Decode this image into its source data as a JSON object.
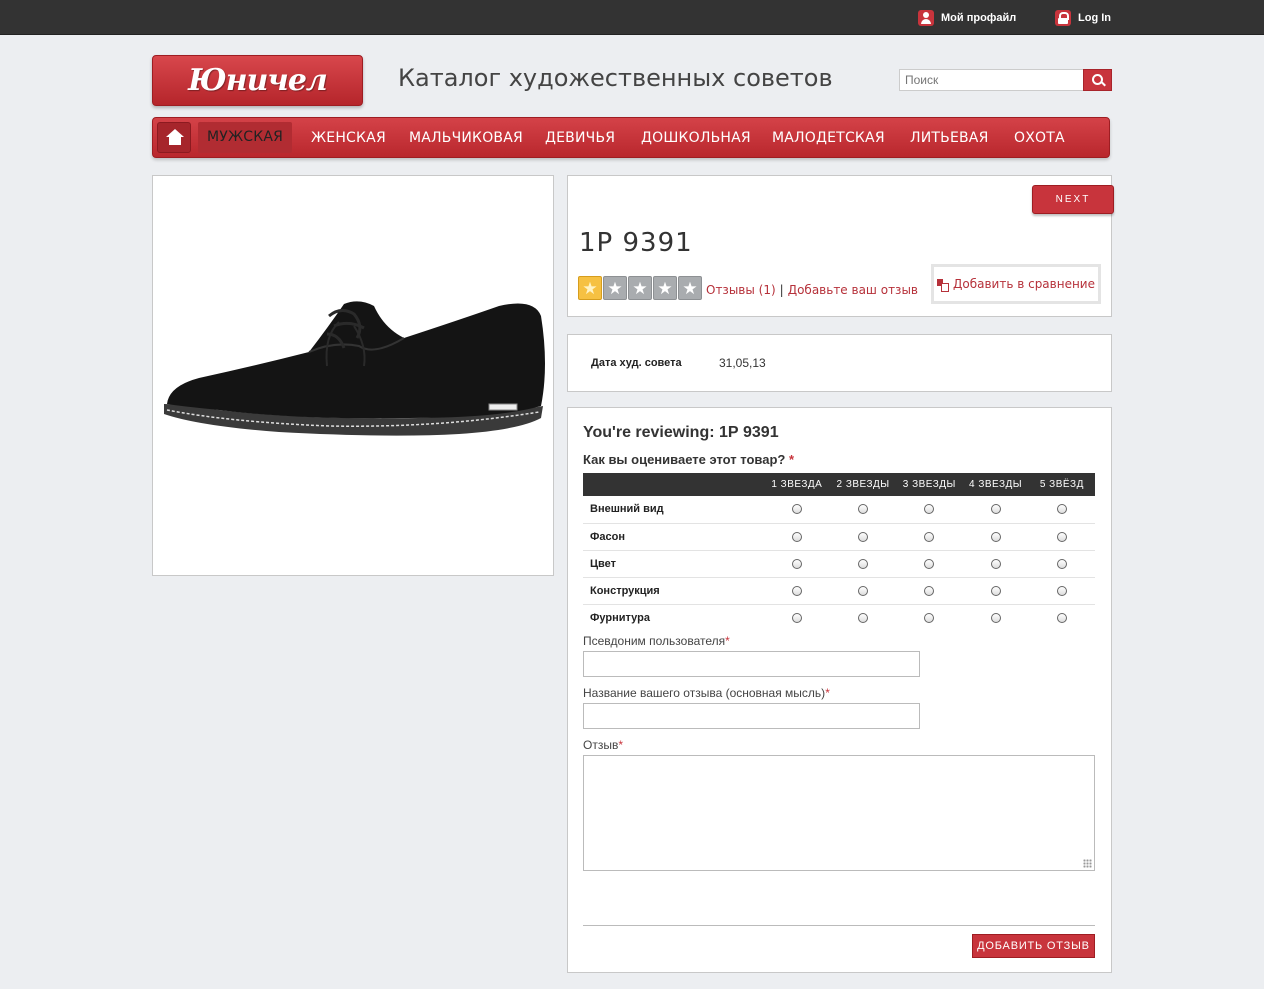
{
  "topbar": {
    "profile_label": "Мой профайл",
    "login_label": "Log In"
  },
  "header": {
    "logo_text": "Юничел",
    "site_title": "Каталог художественных советов",
    "search_placeholder": "Поиск"
  },
  "nav": {
    "items": [
      {
        "label": "МУЖСКАЯ",
        "active": true
      },
      {
        "label": "ЖЕНСКАЯ"
      },
      {
        "label": "МАЛЬЧИКОВАЯ"
      },
      {
        "label": "ДЕВИЧЬЯ"
      },
      {
        "label": "ДОШКОЛЬНАЯ"
      },
      {
        "label": "МАЛОДЕТСКАЯ"
      },
      {
        "label": "ЛИТЬЕВАЯ"
      },
      {
        "label": "ОХОТА"
      }
    ]
  },
  "product": {
    "next_label": "NEXT",
    "name": "1Р 9391",
    "rating": 1,
    "rating_max": 5,
    "reviews_link": "Отзывы (1)",
    "separator": "|",
    "add_review_link": "Добавьте ваш отзыв",
    "compare_label": "Добавить в сравнение"
  },
  "attributes": {
    "label": "Дата худ. совета",
    "value": "31,05,13"
  },
  "review_form": {
    "title": "You're reviewing: 1Р 9391",
    "question": "Как вы оцениваете этот товар?",
    "required_mark": "*",
    "columns": [
      "1 ЗВЕЗДА",
      "2 ЗВЕЗДЫ",
      "3 ЗВЕЗДЫ",
      "4 ЗВЕЗДЫ",
      "5 ЗВЁЗД"
    ],
    "criteria": [
      "Внешний вид",
      "Фасон",
      "Цвет",
      "Конструкция",
      "Фурнитура"
    ],
    "nickname_label": "Псевдоним пользователя",
    "summary_label": "Название вашего отзыва (основная мысль)",
    "review_label": "Отзыв",
    "submit_label": "ДОБАВИТЬ ОТЗЫВ"
  },
  "colors": {
    "accent": "#c8343c",
    "topbar": "#333333",
    "background": "#eceef1"
  }
}
